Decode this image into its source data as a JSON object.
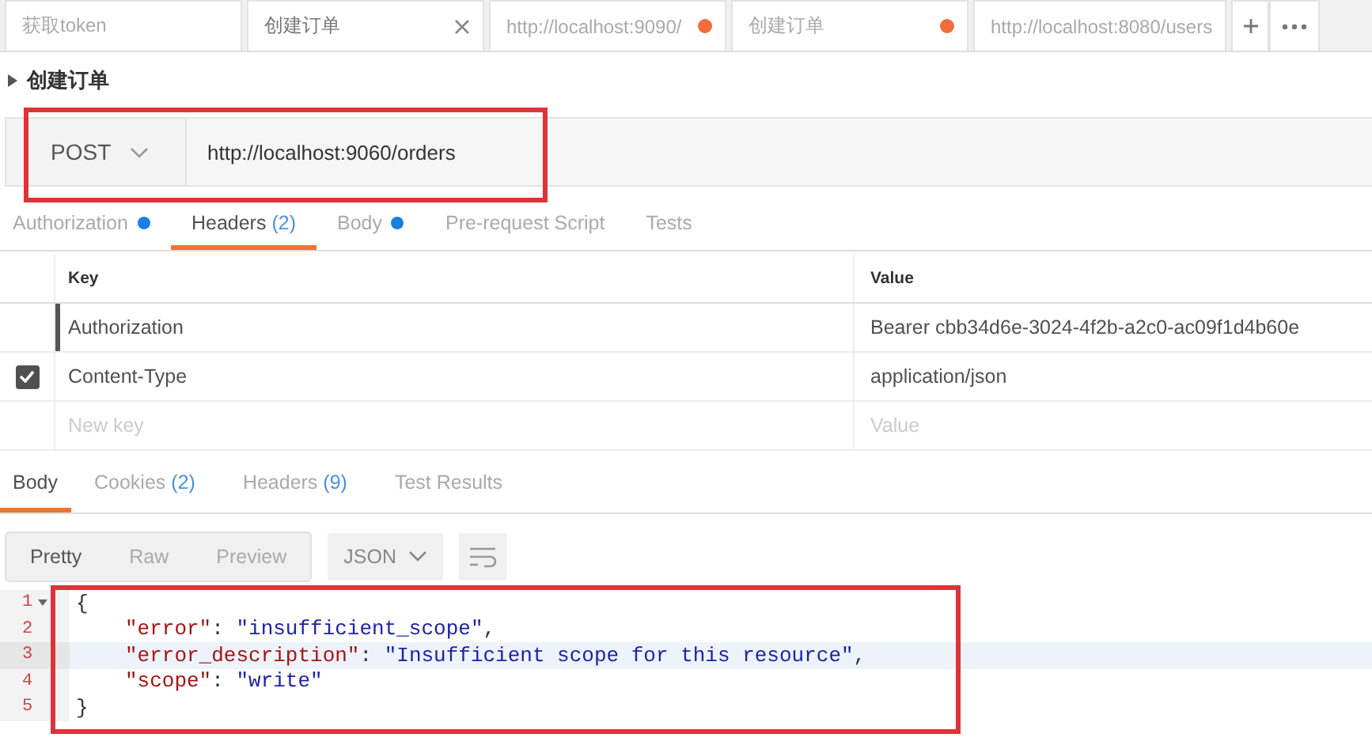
{
  "tabs": [
    {
      "label": "获取token",
      "selected": false,
      "modified": false,
      "closable": false
    },
    {
      "label": "创建订单",
      "selected": true,
      "modified": false,
      "closable": true
    },
    {
      "label": "http://localhost:9090/",
      "selected": false,
      "modified": true,
      "closable": false
    },
    {
      "label": "创建订单",
      "selected": false,
      "modified": true,
      "closable": false
    },
    {
      "label": "http://localhost:8080/users",
      "selected": false,
      "modified": false,
      "closable": false
    }
  ],
  "request": {
    "title": "创建订单",
    "method": "POST",
    "url": "http://localhost:9060/orders"
  },
  "request_tabs": [
    {
      "label": "Authorization",
      "dot": true,
      "selected": false
    },
    {
      "label": "Headers",
      "count": "(2)",
      "dot": false,
      "selected": true
    },
    {
      "label": "Body",
      "dot": true,
      "selected": false
    },
    {
      "label": "Pre-request Script",
      "dot": false,
      "selected": false
    },
    {
      "label": "Tests",
      "dot": false,
      "selected": false
    }
  ],
  "headers_table": {
    "columns": [
      "Key",
      "Value"
    ],
    "rows": [
      {
        "key": "Authorization",
        "value": "Bearer cbb34d6e-3024-4f2b-a2c0-ac09f1d4b60e",
        "checked": false,
        "focused": true
      },
      {
        "key": "Content-Type",
        "value": "application/json",
        "checked": true,
        "focused": false
      }
    ],
    "new_row": {
      "key_placeholder": "New key",
      "value_placeholder": "Value"
    }
  },
  "response_tabs": [
    {
      "label": "Body",
      "selected": true
    },
    {
      "label": "Cookies",
      "count": "(2)",
      "selected": false
    },
    {
      "label": "Headers",
      "count": "(9)",
      "selected": false
    },
    {
      "label": "Test Results",
      "selected": false
    }
  ],
  "view_modes": [
    {
      "label": "Pretty",
      "selected": true
    },
    {
      "label": "Raw",
      "selected": false
    },
    {
      "label": "Preview",
      "selected": false
    }
  ],
  "format": "JSON",
  "code_lines": [
    {
      "number": "1",
      "foldable": true,
      "current": false,
      "indented": false,
      "tokens": [
        {
          "kind": "punct",
          "text": "{"
        }
      ]
    },
    {
      "number": "2",
      "foldable": false,
      "current": false,
      "indented": true,
      "tokens": [
        {
          "kind": "key",
          "text": "\"error\""
        },
        {
          "kind": "punct",
          "text": ": "
        },
        {
          "kind": "string",
          "text": "\"insufficient_scope\""
        },
        {
          "kind": "punct",
          "text": ","
        }
      ]
    },
    {
      "number": "3",
      "foldable": false,
      "current": true,
      "indented": true,
      "tokens": [
        {
          "kind": "key",
          "text": "\"error_description\""
        },
        {
          "kind": "punct",
          "text": ": "
        },
        {
          "kind": "string",
          "text": "\"Insufficient scope for this resource\""
        },
        {
          "kind": "punct",
          "text": ","
        }
      ]
    },
    {
      "number": "4",
      "foldable": false,
      "current": false,
      "indented": true,
      "tokens": [
        {
          "kind": "key",
          "text": "\"scope\""
        },
        {
          "kind": "punct",
          "text": ": "
        },
        {
          "kind": "string",
          "text": "\"write\""
        }
      ]
    },
    {
      "number": "5",
      "foldable": false,
      "current": false,
      "indented": false,
      "tokens": [
        {
          "kind": "punct",
          "text": "}"
        }
      ]
    }
  ]
}
